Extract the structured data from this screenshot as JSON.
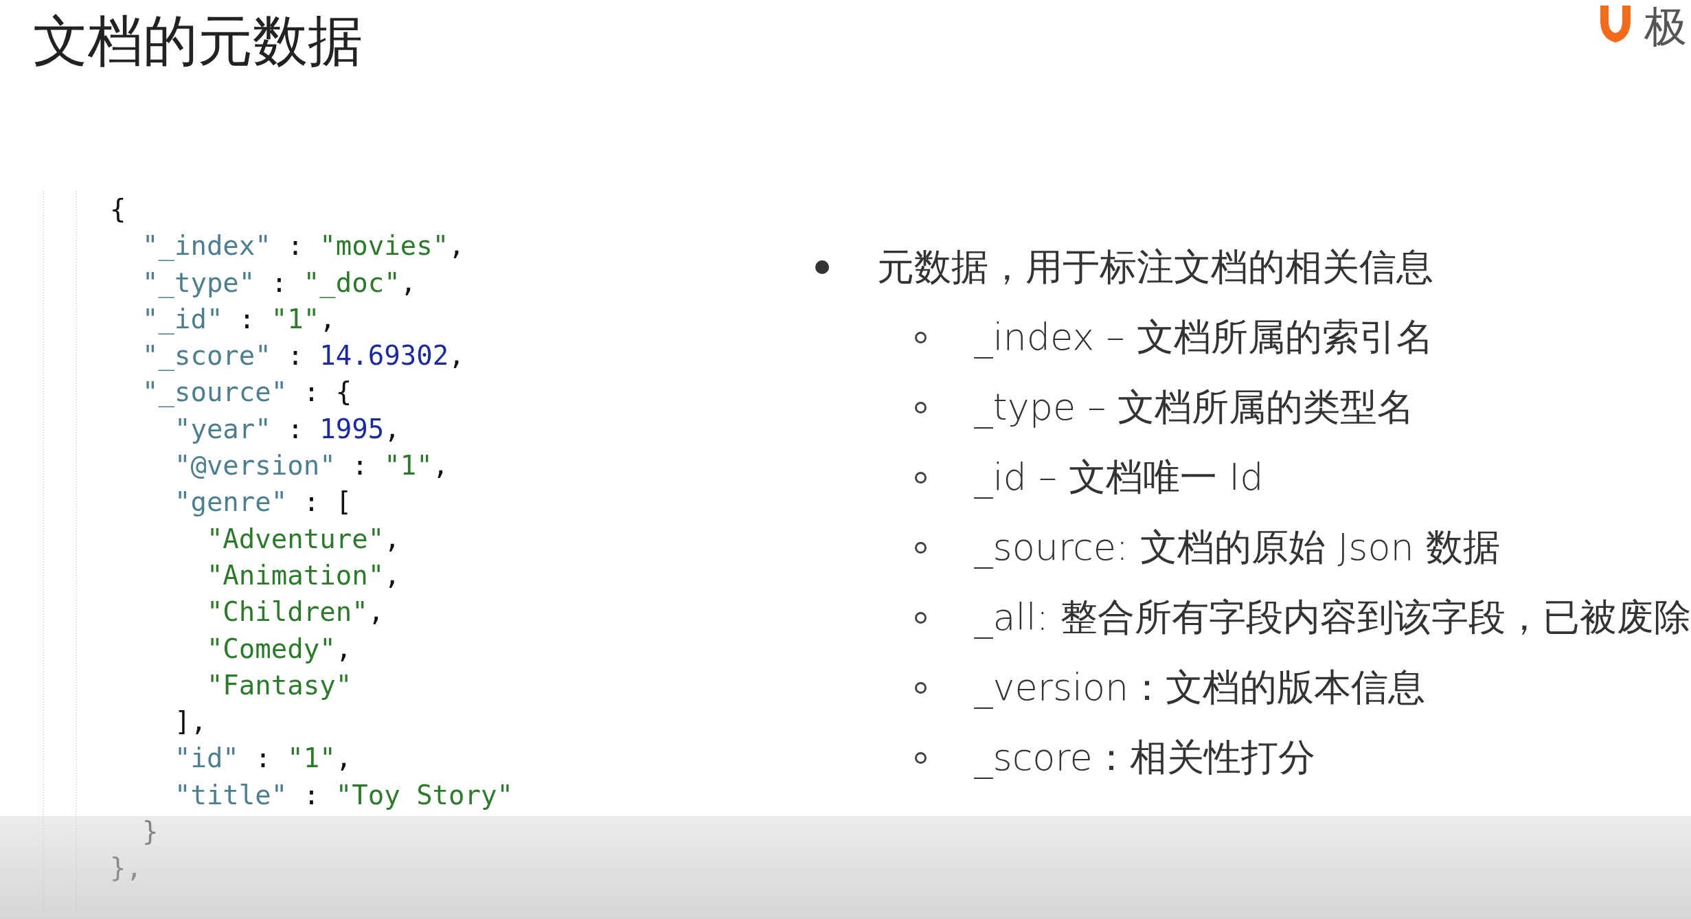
{
  "title": "文档的元数据",
  "logo": {
    "text": "极"
  },
  "code": {
    "lines": [
      [
        {
          "kind": "punct",
          "text": "{"
        }
      ],
      [
        {
          "kind": "key",
          "text": "  \"_index\""
        },
        {
          "kind": "punct",
          "text": " : "
        },
        {
          "kind": "string",
          "text": "\"movies\""
        },
        {
          "kind": "punct",
          "text": ","
        }
      ],
      [
        {
          "kind": "key",
          "text": "  \"_type\""
        },
        {
          "kind": "punct",
          "text": " : "
        },
        {
          "kind": "string",
          "text": "\"_doc\""
        },
        {
          "kind": "punct",
          "text": ","
        }
      ],
      [
        {
          "kind": "key",
          "text": "  \"_id\""
        },
        {
          "kind": "punct",
          "text": " : "
        },
        {
          "kind": "string",
          "text": "\"1\""
        },
        {
          "kind": "punct",
          "text": ","
        }
      ],
      [
        {
          "kind": "key",
          "text": "  \"_score\""
        },
        {
          "kind": "punct",
          "text": " : "
        },
        {
          "kind": "number",
          "text": "14.69302"
        },
        {
          "kind": "punct",
          "text": ","
        }
      ],
      [
        {
          "kind": "key",
          "text": "  \"_source\""
        },
        {
          "kind": "punct",
          "text": " : {"
        }
      ],
      [
        {
          "kind": "key",
          "text": "    \"year\""
        },
        {
          "kind": "punct",
          "text": " : "
        },
        {
          "kind": "number",
          "text": "1995"
        },
        {
          "kind": "punct",
          "text": ","
        }
      ],
      [
        {
          "kind": "key",
          "text": "    \"@version\""
        },
        {
          "kind": "punct",
          "text": " : "
        },
        {
          "kind": "string",
          "text": "\"1\""
        },
        {
          "kind": "punct",
          "text": ","
        }
      ],
      [
        {
          "kind": "key",
          "text": "    \"genre\""
        },
        {
          "kind": "punct",
          "text": " : ["
        }
      ],
      [
        {
          "kind": "string",
          "text": "      \"Adventure\""
        },
        {
          "kind": "punct",
          "text": ","
        }
      ],
      [
        {
          "kind": "string",
          "text": "      \"Animation\""
        },
        {
          "kind": "punct",
          "text": ","
        }
      ],
      [
        {
          "kind": "string",
          "text": "      \"Children\""
        },
        {
          "kind": "punct",
          "text": ","
        }
      ],
      [
        {
          "kind": "string",
          "text": "      \"Comedy\""
        },
        {
          "kind": "punct",
          "text": ","
        }
      ],
      [
        {
          "kind": "string",
          "text": "      \"Fantasy\""
        }
      ],
      [
        {
          "kind": "punct",
          "text": "    ],"
        }
      ],
      [
        {
          "kind": "key",
          "text": "    \"id\""
        },
        {
          "kind": "punct",
          "text": " : "
        },
        {
          "kind": "string",
          "text": "\"1\""
        },
        {
          "kind": "punct",
          "text": ","
        }
      ],
      [
        {
          "kind": "key",
          "text": "    \"title\""
        },
        {
          "kind": "punct",
          "text": " : "
        },
        {
          "kind": "string",
          "text": "\"Toy Story\""
        }
      ],
      [
        {
          "kind": "punct",
          "text": "  }"
        }
      ],
      [
        {
          "kind": "punct",
          "text": "},"
        }
      ]
    ]
  },
  "bullets": [
    {
      "text": "元数据，用于标注文档的相关信息",
      "children": [
        {
          "text": "_index – 文档所属的索引名"
        },
        {
          "text": "_type – 文档所属的类型名"
        },
        {
          "text": "_id – 文档唯一 Id"
        },
        {
          "text": "_source: 文档的原始 Json 数据"
        },
        {
          "text": "_all: 整合所有字段内容到该字段，已被废除"
        },
        {
          "text": "_version：文档的版本信息"
        },
        {
          "text": "_score：相关性打分"
        }
      ]
    }
  ]
}
